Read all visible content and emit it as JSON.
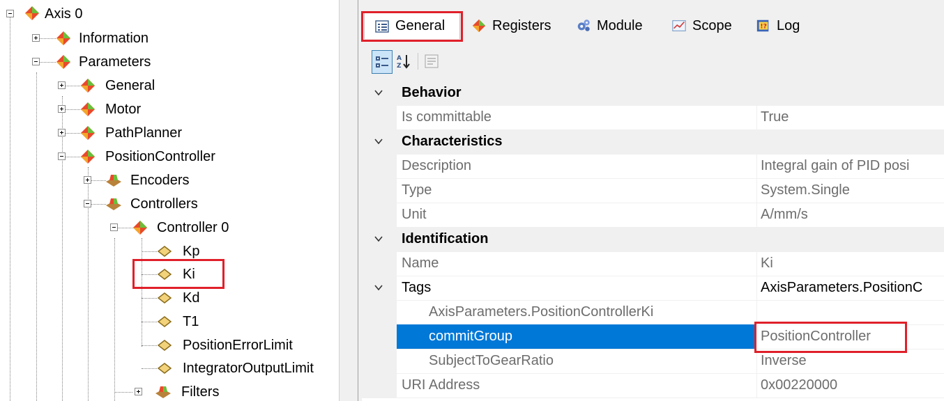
{
  "tree": {
    "nodes": [
      {
        "label": "Axis 0"
      },
      {
        "label": "Information"
      },
      {
        "label": "Parameters"
      },
      {
        "label": "General"
      },
      {
        "label": "Motor"
      },
      {
        "label": "PathPlanner"
      },
      {
        "label": "PositionController"
      },
      {
        "label": "Encoders"
      },
      {
        "label": "Controllers"
      },
      {
        "label": "Controller 0"
      },
      {
        "label": "Kp"
      },
      {
        "label": "Ki"
      },
      {
        "label": "Kd"
      },
      {
        "label": "T1"
      },
      {
        "label": "PositionErrorLimit"
      },
      {
        "label": "IntegratorOutputLimit"
      },
      {
        "label": "Filters"
      }
    ]
  },
  "tabs": [
    {
      "label": "General",
      "icon": "list-icon"
    },
    {
      "label": "Registers",
      "icon": "diamond-icon"
    },
    {
      "label": "Module",
      "icon": "gears-icon"
    },
    {
      "label": "Scope",
      "icon": "chart-icon"
    },
    {
      "label": "Log",
      "icon": "log-icon"
    }
  ],
  "toolbar": {
    "categorized": "categorized-icon",
    "alphabetical": "sort-az-icon",
    "pages": "property-pages-icon"
  },
  "grid": {
    "rows": [
      {
        "type": "category",
        "name": "Behavior"
      },
      {
        "type": "prop",
        "name": "Is committable",
        "value": "True"
      },
      {
        "type": "category",
        "name": "Characteristics"
      },
      {
        "type": "prop",
        "name": "Description",
        "value": "Integral gain of PID posi"
      },
      {
        "type": "prop",
        "name": "Type",
        "value": "System.Single"
      },
      {
        "type": "prop",
        "name": "Unit",
        "value": "A/mm/s"
      },
      {
        "type": "category",
        "name": "Identification"
      },
      {
        "type": "prop",
        "name": "Name",
        "value": "Ki"
      },
      {
        "type": "expandable",
        "name": "Tags",
        "value": "AxisParameters.PositionC"
      },
      {
        "type": "sub",
        "name": "AxisParameters.PositionControllerKi",
        "value": ""
      },
      {
        "type": "sub-selected",
        "name": "commitGroup",
        "value": "PositionController"
      },
      {
        "type": "sub",
        "name": "SubjectToGearRatio",
        "value": "Inverse"
      },
      {
        "type": "prop",
        "name": "URI Address",
        "value": "0x00220000"
      }
    ]
  },
  "colors": {
    "highlight_box": "#e0202a",
    "selection": "#0078d7",
    "category_bg": "#f0f0f0"
  }
}
